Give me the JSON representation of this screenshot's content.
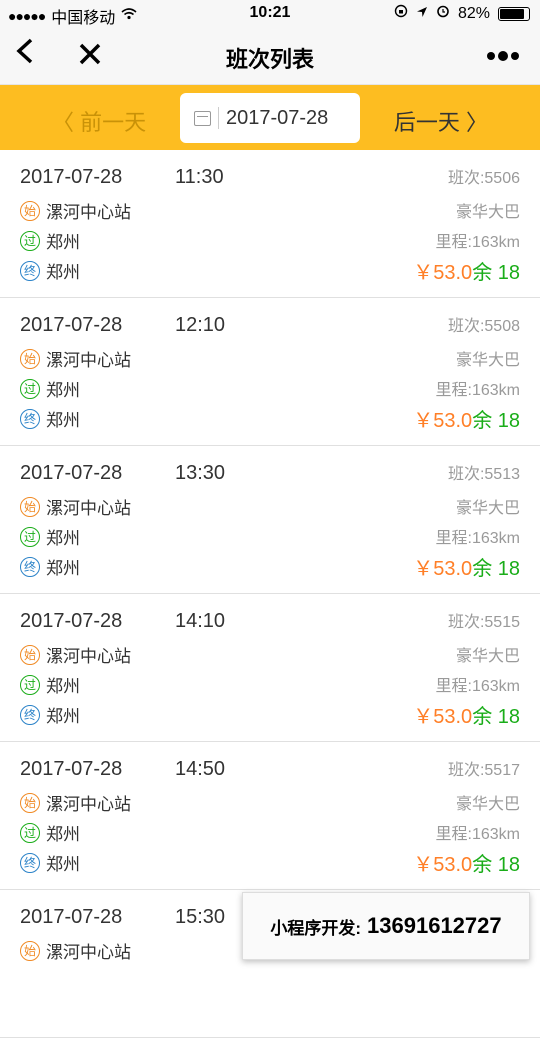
{
  "status_bar": {
    "carrier": "中国移动",
    "time": "10:21",
    "battery": "82%"
  },
  "nav": {
    "back_icon": "chevron-left-icon",
    "close_icon": "close-icon",
    "title": "班次列表",
    "more_icon": "more-icon"
  },
  "date_bar": {
    "prev": "〈 前一天",
    "date": "2017-07-28",
    "next": "后一天 〉"
  },
  "schedules": [
    {
      "date": "2017-07-28",
      "time": "11:30",
      "bus_no": "班次:5506",
      "bus_type": "豪华大巴",
      "distance": "里程:163km",
      "price": "￥53.0",
      "seats": "余 18",
      "start": "漯河中心站",
      "via": "郑州",
      "end": "郑州"
    },
    {
      "date": "2017-07-28",
      "time": "12:10",
      "bus_no": "班次:5508",
      "bus_type": "豪华大巴",
      "distance": "里程:163km",
      "price": "￥53.0",
      "seats": "余 18",
      "start": "漯河中心站",
      "via": "郑州",
      "end": "郑州"
    },
    {
      "date": "2017-07-28",
      "time": "13:30",
      "bus_no": "班次:5513",
      "bus_type": "豪华大巴",
      "distance": "里程:163km",
      "price": "￥53.0",
      "seats": "余 18",
      "start": "漯河中心站",
      "via": "郑州",
      "end": "郑州"
    },
    {
      "date": "2017-07-28",
      "time": "14:10",
      "bus_no": "班次:5515",
      "bus_type": "豪华大巴",
      "distance": "里程:163km",
      "price": "￥53.0",
      "seats": "余 18",
      "start": "漯河中心站",
      "via": "郑州",
      "end": "郑州"
    },
    {
      "date": "2017-07-28",
      "time": "14:50",
      "bus_no": "班次:5517",
      "bus_type": "豪华大巴",
      "distance": "里程:163km",
      "price": "￥53.0",
      "seats": "余 18",
      "start": "漯河中心站",
      "via": "郑州",
      "end": "郑州"
    },
    {
      "date": "2017-07-28",
      "time": "15:30",
      "start": "漯河中心站"
    }
  ],
  "badges": {
    "start": "始",
    "via": "过",
    "end": "终"
  },
  "promo": {
    "label": "小程序开发:",
    "phone": "13691612727"
  },
  "colors": {
    "accent": "#fdbd21",
    "price": "#ff7f27",
    "seats": "#1aad19"
  }
}
